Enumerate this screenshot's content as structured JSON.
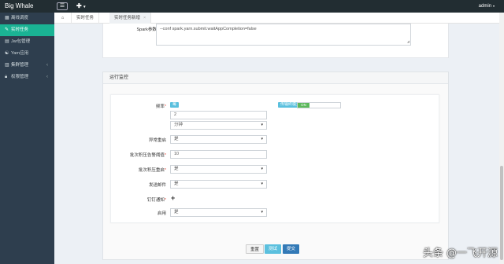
{
  "app": {
    "brand": "Big Whale",
    "user": "admin"
  },
  "sidebar": {
    "items": [
      {
        "label": "离线调度"
      },
      {
        "label": "实时任务"
      },
      {
        "label": "Jar包管理"
      },
      {
        "label": "Yarn应用"
      },
      {
        "label": "集群管理"
      },
      {
        "label": "权限管理"
      }
    ]
  },
  "tabs": [
    {
      "label": "实时任务"
    },
    {
      "label": "实时任务新增"
    }
  ],
  "spark_params": {
    "label": "Spark参数",
    "value": "--conf spark.yarn.submit.waitAppCompletion=false"
  },
  "monitor": {
    "title": "运行监控",
    "freq_label": "频率",
    "freq_badge": "每",
    "freq_value": "2",
    "freq_unit": "分钟",
    "alert_mode_label": "传输终模式",
    "toggle_on": "ON",
    "restart_label": "异常重启",
    "restart_value": "是",
    "batch_threshold_label": "批次积压告警阈值",
    "batch_threshold_value": "10",
    "batch_restart_label": "批次积压重启",
    "batch_restart_value": "是",
    "email_label": "发送邮件",
    "email_value": "是",
    "dingding_label": "钉钉通知",
    "enable_label": "启用",
    "enable_value": "是"
  },
  "actions": {
    "reset": "重置",
    "test": "测试",
    "submit": "提交"
  },
  "watermark": "头条 @一飞开源"
}
